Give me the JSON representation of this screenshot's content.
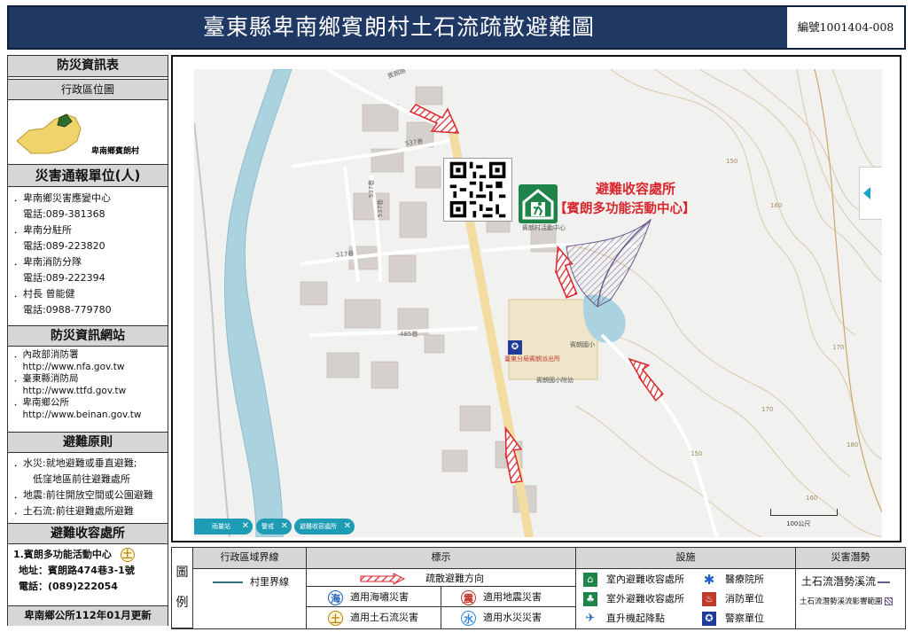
{
  "title": "臺東縣卑南鄉賓朗村土石流疏散避難圖",
  "serial": "編號1001404-008",
  "left": {
    "info_header": "防災資訊表",
    "admin_header": "行政區位圖",
    "admin_label": "卑南鄉賓朗村",
    "report_header": "災害通報單位(人)",
    "report_items": [
      "．卑南鄉災害應變中心",
      "　電話:089-381368",
      "．卑南分駐所",
      "　電話:089-223820",
      "．卑南消防分隊",
      "　電話:089-222394",
      "．村長 曾能健",
      "　電話:0988-779780"
    ],
    "web_header": "防災資訊網站",
    "web_items": [
      "．內政部消防署",
      "　http://www.nfa.gov.tw",
      "．臺東縣消防局",
      "　http://www.ttfd.gov.tw",
      "．卑南鄉公所",
      "　http://www.beinan.gov.tw"
    ],
    "principle_header": "避難原則",
    "principle_items": [
      "．水災:就地避難或垂直避難;",
      "　　低窪地區前往避難處所",
      "．地震:前往開放空間或公園避難",
      "．土石流:前往避難處所避難"
    ],
    "shelter_header": "避難收容處所",
    "shelter_name": "1.賓朗多功能活動中心",
    "shelter_badge": "土",
    "shelter_address": "地址：賓朗路474巷3-1號",
    "shelter_phone": "電話：(089)222054",
    "updated": "卑南鄉公所112年01月更新"
  },
  "map": {
    "shelter_title": "避難收容處所",
    "shelter_name": "【賓朗多功能活動中心】",
    "road_labels": [
      "537巷",
      "537巷",
      "537巷",
      "517巷",
      "485巷",
      "賓朗路"
    ],
    "place_labels": [
      "賓朗村活動中心",
      "臺東分局賓朗派出所",
      "賓朗國小",
      "賓朗國小附幼"
    ],
    "contours": [
      "150",
      "160",
      "170",
      "180",
      "170",
      "160",
      "150"
    ],
    "scale_label": "100公尺",
    "chips": [
      "雨量站",
      "警戒",
      "避難收容處所"
    ]
  },
  "legend": {
    "example_label": [
      "圖",
      "例"
    ],
    "col_admin": "行政區域界線",
    "admin_line_label": "村里界線",
    "col_sign": "標示",
    "evac_label": "疏散避難方向",
    "disasters": [
      {
        "badge": "海",
        "label": "適用海嘯災害",
        "color": "#1f5fbf"
      },
      {
        "badge": "震",
        "label": "適用地震災害",
        "color": "#c0392b"
      },
      {
        "badge": "土",
        "label": "適用土石流災害",
        "color": "#b8860b"
      },
      {
        "badge": "水",
        "label": "適用水災災害",
        "color": "#2e86de"
      }
    ],
    "col_facility": "設施",
    "facilities": [
      {
        "label": "室內避難收容處所",
        "icon": "indoor-shelter-icon",
        "color": "#1e8449"
      },
      {
        "label": "醫療院所",
        "icon": "medical-icon",
        "color": "#1f5fbf"
      },
      {
        "label": "室外避難收容處所",
        "icon": "outdoor-shelter-icon",
        "color": "#1e8449"
      },
      {
        "label": "消防單位",
        "icon": "fire-dept-icon",
        "color": "#c0392b"
      },
      {
        "label": "直升機起降點",
        "icon": "helipad-icon",
        "color": "#1f5fbf"
      },
      {
        "label": "警察單位",
        "icon": "police-icon",
        "color": "#1f3c9c"
      }
    ],
    "col_potential": "災害潛勢",
    "potential_stream": "土石流潛勢溪流",
    "potential_area": "土石流潛勢溪流影響範圍"
  }
}
